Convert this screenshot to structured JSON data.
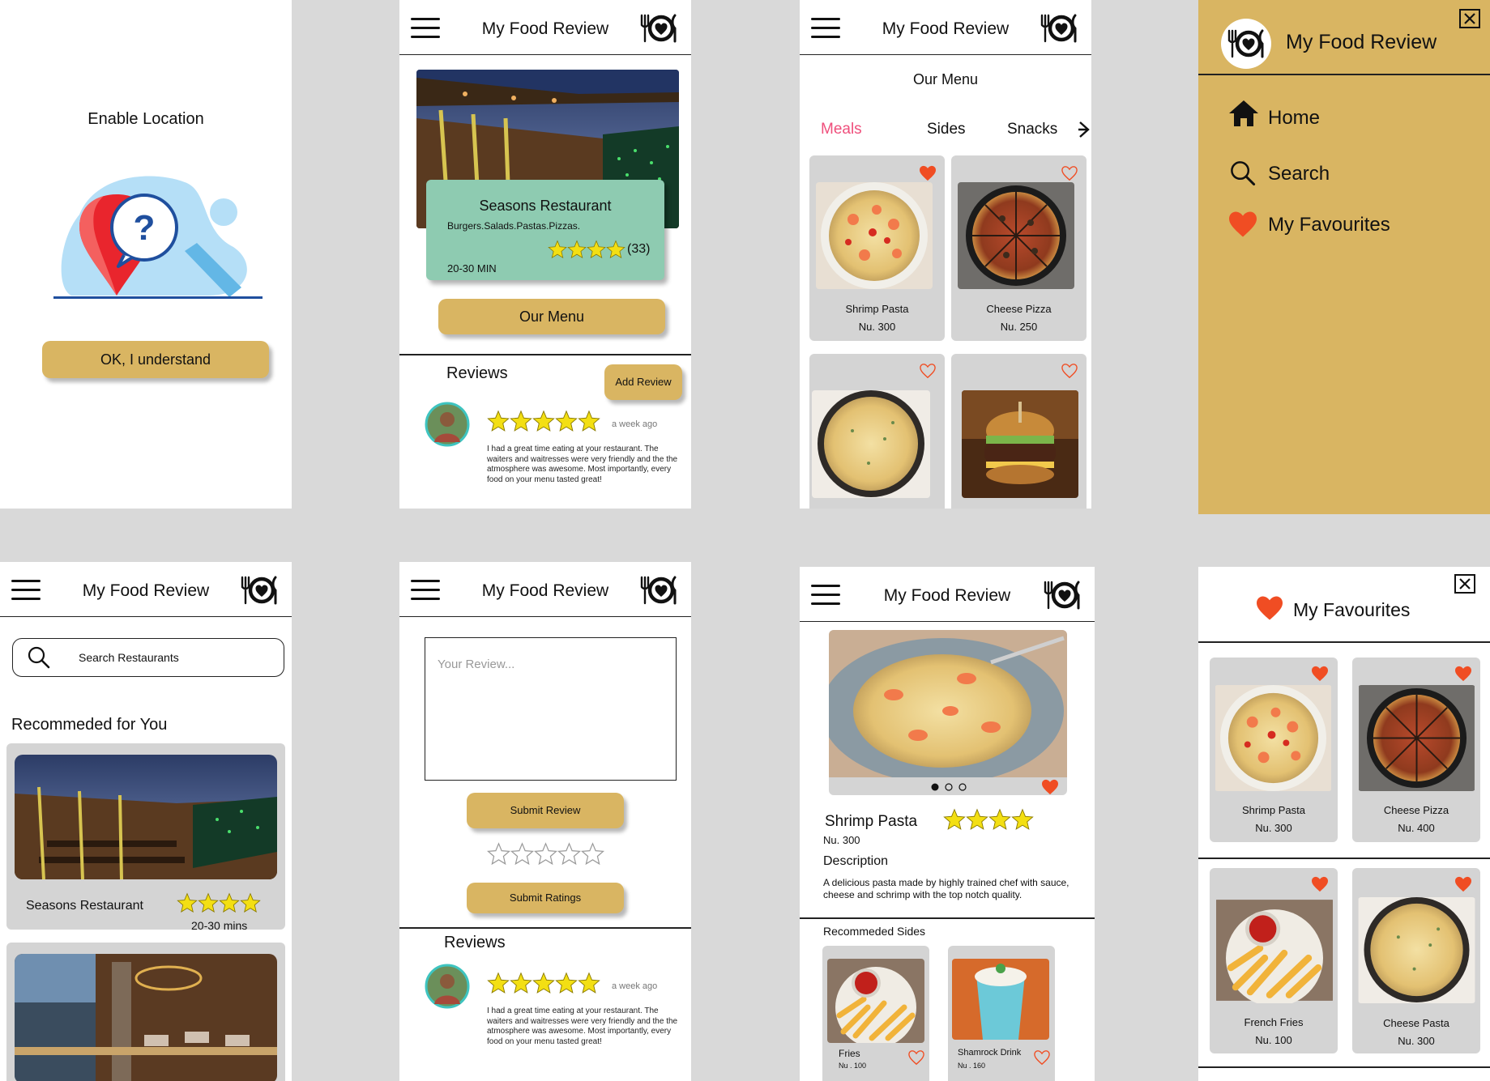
{
  "app": {
    "title": "My Food Review"
  },
  "colors": {
    "accent": "#d9b562",
    "mint": "#8ecbb1",
    "heart": "#f04d23",
    "pink": "#ef4f7c",
    "star": "#f3df13",
    "bg": "#d9d9d9"
  },
  "location": {
    "title": "Enable Location",
    "button": "OK, I understand"
  },
  "restaurant": {
    "name": "Seasons Restaurant",
    "tags": "Burgers.Salads.Pastas.Pizzas.",
    "rating_count": "(33)",
    "time": "20-30 MIN",
    "menu_button": "Our Menu",
    "reviews_heading": "Reviews",
    "add_review": "Add Review"
  },
  "review": {
    "time": "a week ago",
    "text": "I had a great time eating at your restaurant. The waiters and waitresses were very friendly and the the atmosphere was awesome. Most importantly, every food on your menu tasted great!"
  },
  "menu": {
    "title": "Our Menu",
    "tabs": [
      "Meals",
      "Sides",
      "Snacks"
    ],
    "items": [
      {
        "name": "Shrimp Pasta",
        "price": "Nu. 300",
        "fav": true
      },
      {
        "name": "Cheese Pizza",
        "price": "Nu. 250",
        "fav": false
      },
      {
        "name": "",
        "price": "",
        "fav": false
      },
      {
        "name": "",
        "price": "",
        "fav": false
      }
    ]
  },
  "drawer": {
    "items": [
      "Home",
      "Search",
      "My Favourites"
    ],
    "icons": [
      "home-icon",
      "search-icon",
      "heart-icon"
    ]
  },
  "search": {
    "placeholder": "Search Restaurants",
    "recommended": "Recommeded for You",
    "card": {
      "name": "Seasons Restaurant",
      "time": "20-30 mins"
    }
  },
  "write": {
    "placeholder": "Your Review...",
    "submit_review": "Submit Review",
    "submit_ratings": "Submit Ratings",
    "reviews_heading": "Reviews"
  },
  "detail": {
    "name": "Shrimp Pasta",
    "price": "Nu. 300",
    "desc_label": "Description",
    "desc": "A delicious pasta made by highly trained chef with sauce, cheese and schrimp with the top notch quality.",
    "sides_label": "Recommeded Sides",
    "sides": [
      {
        "name": "Fries",
        "price": "Nu . 100"
      },
      {
        "name": "Shamrock Drink",
        "price": "Nu . 160"
      }
    ]
  },
  "favourites": {
    "title": "My Favourites",
    "items": [
      {
        "name": "Shrimp Pasta",
        "price": "Nu. 300"
      },
      {
        "name": "Cheese Pizza",
        "price": "Nu. 400"
      },
      {
        "name": "French Fries",
        "price": "Nu. 100"
      },
      {
        "name": "Cheese Pasta",
        "price": "Nu. 300"
      }
    ]
  }
}
